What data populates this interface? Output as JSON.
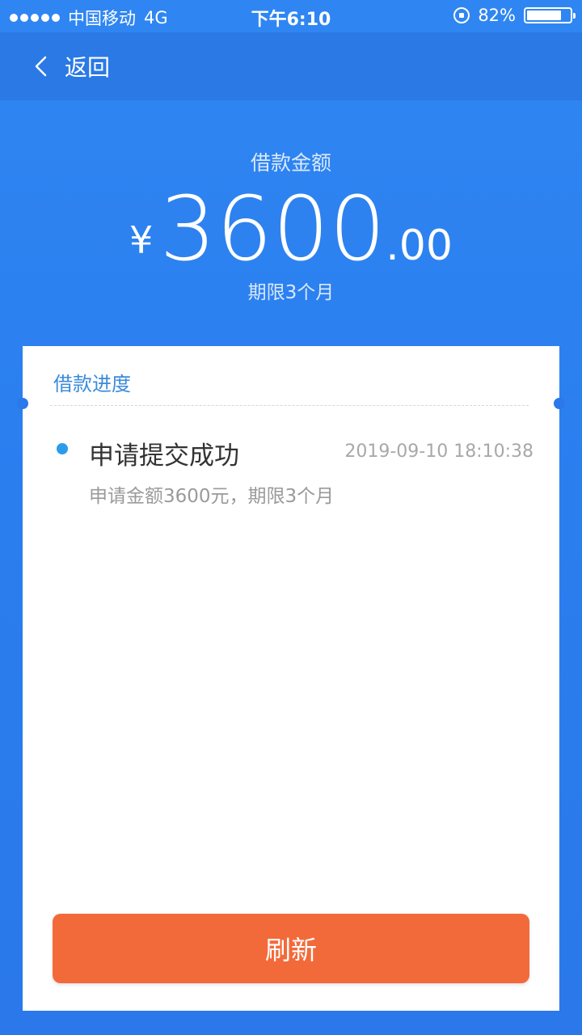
{
  "status_bar": {
    "carrier": "中国移动",
    "network": "4G",
    "time": "下午6:10",
    "battery_text": "82%",
    "battery_level": 0.82,
    "lock_icon": "orientation-lock-icon"
  },
  "nav": {
    "back_label": "返回",
    "back_icon": "chevron-left-icon"
  },
  "loan": {
    "title": "借款金额",
    "currency_symbol": "¥",
    "amount_int": "3600",
    "amount_dec": ".00",
    "term": "期限3个月"
  },
  "progress": {
    "title": "借款进度",
    "items": [
      {
        "status": "申请提交成功",
        "time": "2019-09-10 18:10:38",
        "description": "申请金额3600元，期限3个月"
      }
    ]
  },
  "actions": {
    "refresh_label": "刷新"
  },
  "colors": {
    "background": "#2b7fef",
    "accent": "#2c9bec",
    "button": "#f36a3a"
  }
}
